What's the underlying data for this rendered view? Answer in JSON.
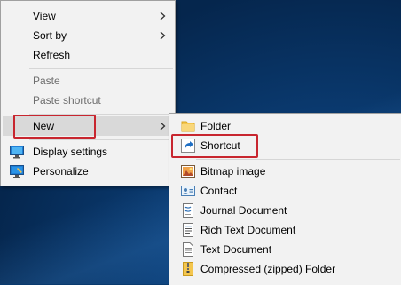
{
  "context_menu": {
    "items": [
      {
        "label": "View",
        "has_submenu": true,
        "disabled": false
      },
      {
        "label": "Sort by",
        "has_submenu": true,
        "disabled": false
      },
      {
        "label": "Refresh",
        "has_submenu": false,
        "disabled": false
      },
      {
        "label": "Paste",
        "has_submenu": false,
        "disabled": true
      },
      {
        "label": "Paste shortcut",
        "has_submenu": false,
        "disabled": true
      },
      {
        "label": "New",
        "has_submenu": true,
        "disabled": false,
        "highlighted": true
      },
      {
        "label": "Display settings",
        "icon": "display-settings-icon"
      },
      {
        "label": "Personalize",
        "icon": "personalize-icon"
      }
    ]
  },
  "new_submenu": {
    "items": [
      {
        "label": "Folder",
        "icon": "folder-icon"
      },
      {
        "label": "Shortcut",
        "icon": "shortcut-icon"
      },
      {
        "label": "Bitmap image",
        "icon": "bitmap-image-icon"
      },
      {
        "label": "Contact",
        "icon": "contact-icon"
      },
      {
        "label": "Journal Document",
        "icon": "journal-document-icon"
      },
      {
        "label": "Rich Text Document",
        "icon": "rich-text-document-icon"
      },
      {
        "label": "Text Document",
        "icon": "text-document-icon"
      },
      {
        "label": "Compressed (zipped) Folder",
        "icon": "zip-folder-icon"
      }
    ]
  },
  "colors": {
    "highlight_box": "#c8262f",
    "menu_bg": "#f2f2f2",
    "hover_bg": "#d9d9d9",
    "disabled_text": "#6d6d6d"
  }
}
